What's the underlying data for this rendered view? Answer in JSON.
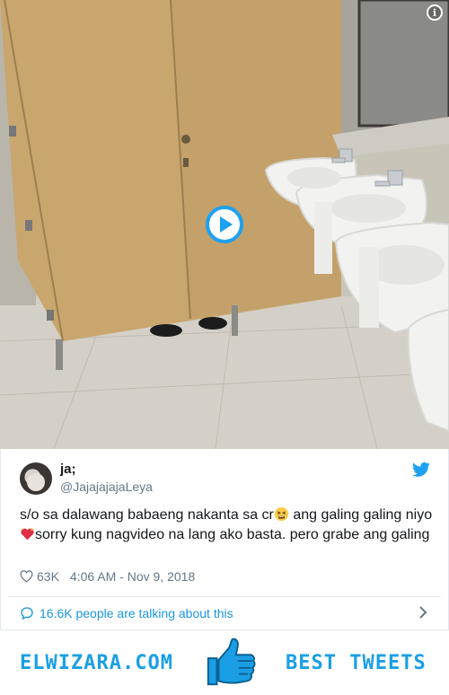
{
  "media": {
    "info_glyph": "i",
    "play_icon": "play-icon"
  },
  "tweet": {
    "display_name": "ja;",
    "handle": "@JajajajajaLeya",
    "text_part1": "s/o sa dalawang babaeng nakanta sa cr",
    "text_part2": " ang galing galing niyo",
    "text_part3": "sorry kung nagvideo na lang ako basta. pero grabe ang galing",
    "likes": "63K",
    "timestamp": "4:06 AM - Nov 9, 2018",
    "talking": "16.6K people are talking about this"
  },
  "footer": {
    "site": "ELWIZARA.COM",
    "tagline": "BEST TWEETS"
  },
  "colors": {
    "accent": "#1da1f2",
    "link": "#1b95e0",
    "muted": "#657786",
    "banner_text": "#1a9fe6"
  }
}
